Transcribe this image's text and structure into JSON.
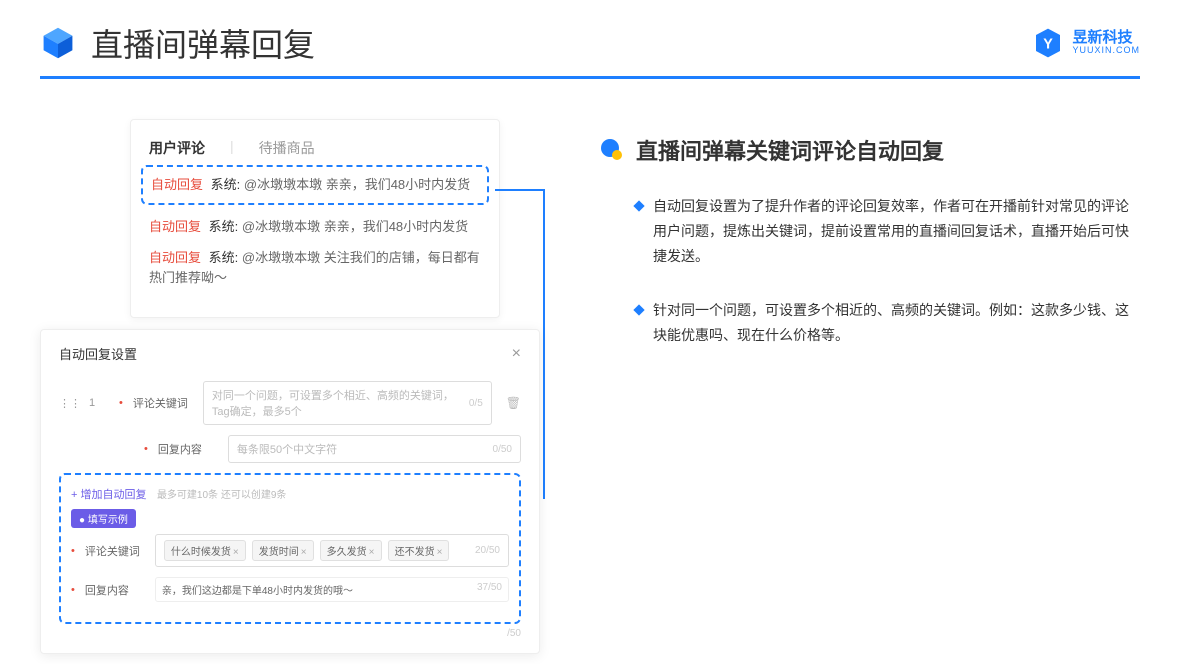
{
  "header": {
    "title": "直播间弹幕回复",
    "brand_name": "昱新科技",
    "brand_url": "YUUXIN.COM"
  },
  "card1": {
    "tab_active": "用户评论",
    "tab_inactive": "待播商品",
    "comments": {
      "c1": {
        "auto": "自动回复",
        "sys": "系统:",
        "text": "@冰墩墩本墩 亲亲，我们48小时内发货"
      },
      "c2": {
        "auto": "自动回复",
        "sys": "系统:",
        "text": "@冰墩墩本墩 亲亲，我们48小时内发货"
      },
      "c3": {
        "auto": "自动回复",
        "sys": "系统:",
        "text": "@冰墩墩本墩 关注我们的店铺，每日都有热门推荐呦～"
      }
    }
  },
  "card2": {
    "title": "自动回复设置",
    "row_num": "1",
    "label_keyword": "评论关键词",
    "keyword_placeholder": "对同一个问题，可设置多个相近、高频的关键词，Tag确定，最多5个",
    "keyword_counter": "0/5",
    "label_content": "回复内容",
    "content_placeholder": "每条限50个中文字符",
    "content_counter": "0/50",
    "add_link": "+ 增加自动回复",
    "add_hint": "最多可建10条 还可以创建9条",
    "example_tag": "● 填写示例",
    "example_label_kw": "评论关键词",
    "tags": {
      "t1": "什么时候发货",
      "t2": "发货时间",
      "t3": "多久发货",
      "t4": "还不发货"
    },
    "example_kw_counter": "20/50",
    "example_label_content": "回复内容",
    "example_content": "亲，我们这边都是下单48小时内发货的哦～",
    "example_content_counter": "37/50",
    "trailing_counter": "/50"
  },
  "right": {
    "section_title": "直播间弹幕关键词评论自动回复",
    "bullet1": "自动回复设置为了提升作者的评论回复效率，作者可在开播前针对常见的评论用户问题，提炼出关键词，提前设置常用的直播间回复话术，直播开始后可快捷发送。",
    "bullet2": "针对同一个问题，可设置多个相近的、高频的关键词。例如：这款多少钱、这块能优惠吗、现在什么价格等。"
  }
}
